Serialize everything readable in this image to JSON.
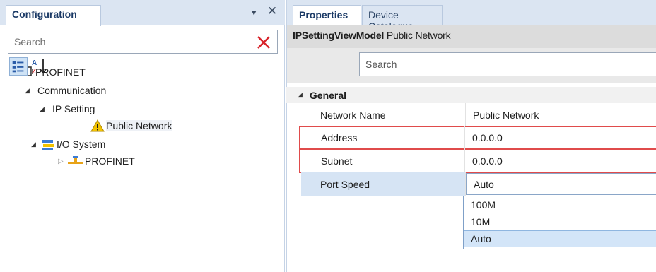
{
  "configuration_panel": {
    "tab_label": "Configuration",
    "search": {
      "placeholder": "Search",
      "value": ""
    },
    "icons": {
      "pin": "dropdown-pin-icon",
      "close": "close-icon",
      "clear": "clear-x-icon"
    },
    "tree": [
      {
        "label": "PROFINET",
        "expanded": true,
        "icon": "device-icon"
      },
      {
        "label": "Communication",
        "expanded": true,
        "icon": "none"
      },
      {
        "label": "IP Setting",
        "expanded": true,
        "icon": "none"
      },
      {
        "label": "Public Network",
        "expanded": false,
        "icon": "warning-icon",
        "selected": true
      },
      {
        "label": "I/O System",
        "expanded": true,
        "icon": "io-system-icon"
      },
      {
        "label": "PROFINET",
        "expanded": false,
        "icon": "network-icon"
      }
    ]
  },
  "properties_panel": {
    "tabs": [
      {
        "label": "Properties",
        "active": true
      },
      {
        "label": "Device Catalogue",
        "active": false
      }
    ],
    "title": {
      "object": "IPSettingViewModel",
      "name": "Public Network"
    },
    "toolbar": {
      "categorized_icon": "categorized-view-icon",
      "alphabetical_icon": "sort-alphabetical-icon",
      "search_placeholder": "Search"
    },
    "category": {
      "label": "General",
      "expanded": true
    },
    "properties": [
      {
        "name": "Network Name",
        "value": "Public Network"
      },
      {
        "name": "Address",
        "value": "0.0.0.0"
      },
      {
        "name": "Subnet",
        "value": "0.0.0.0"
      },
      {
        "name": "Port Speed",
        "value": "Auto"
      }
    ],
    "port_speed_options": [
      "100M",
      "10M",
      "Auto"
    ],
    "port_speed_selected": "Auto"
  },
  "colors": {
    "header_bg": "#dbe5f2",
    "tab_text": "#1b3a66",
    "highlight_outline": "#e04b4b",
    "selection": "#d3e5f8",
    "warning": "#f2c200"
  }
}
